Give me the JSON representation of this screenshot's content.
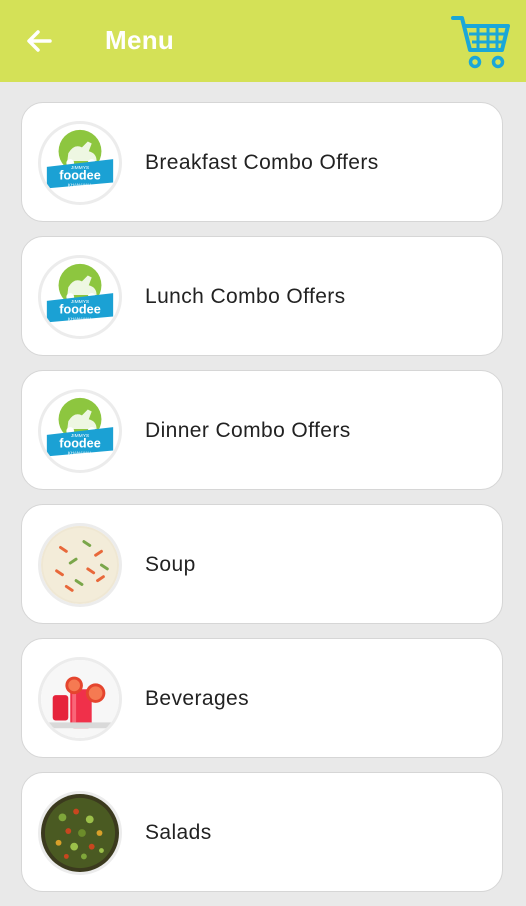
{
  "header": {
    "title": "Menu",
    "back_icon": "arrow-left-icon",
    "cart_icon": "shopping-cart-icon",
    "accent_color": "#d4e157",
    "cart_color": "#1aa7d8"
  },
  "logo": {
    "line1": "JIMMYS",
    "line2": "foodee",
    "line3": "KHANAWAL"
  },
  "menu": {
    "items": [
      {
        "label": "Breakfast Combo Offers",
        "image": "foodee-logo"
      },
      {
        "label": "Lunch Combo Offers",
        "image": "foodee-logo"
      },
      {
        "label": "Dinner Combo Offers",
        "image": "foodee-logo"
      },
      {
        "label": "Soup",
        "image": "soup-bowl"
      },
      {
        "label": "Beverages",
        "image": "red-drinks"
      },
      {
        "label": "Salads",
        "image": "salad-bowl"
      }
    ]
  }
}
